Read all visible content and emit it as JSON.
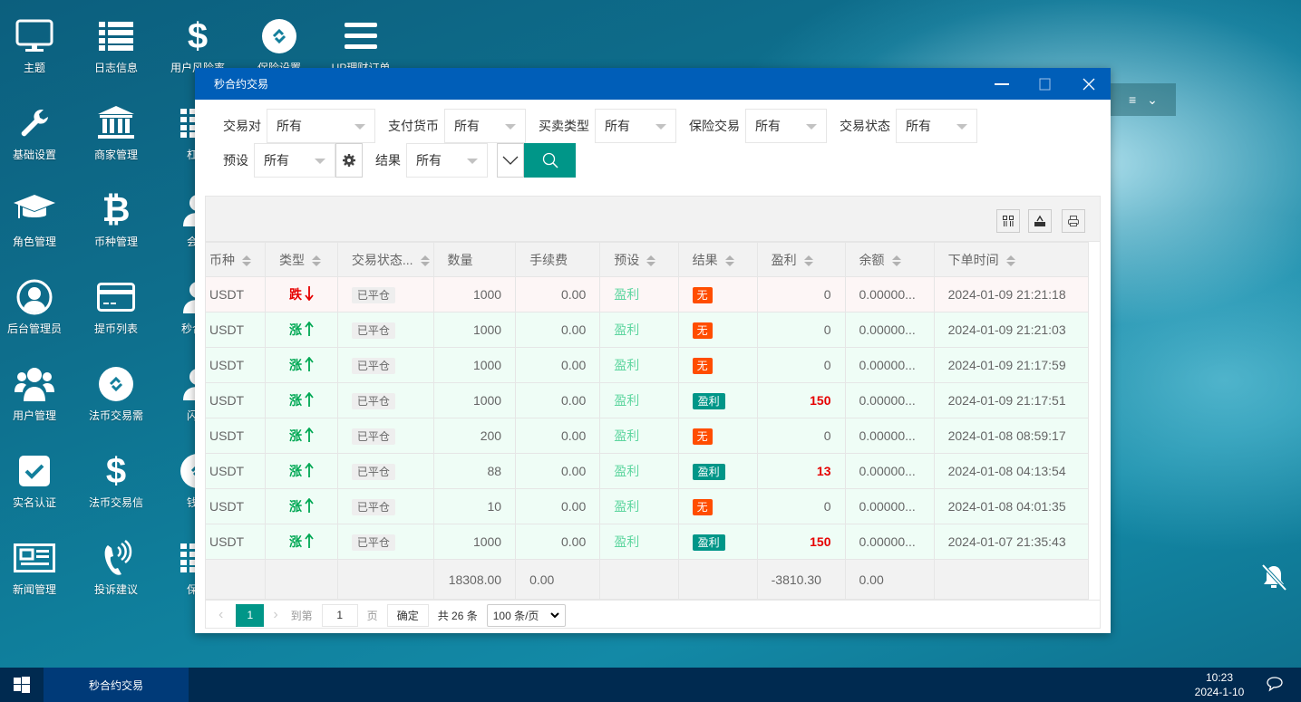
{
  "desktop": {
    "icons": [
      {
        "label": "主题",
        "icon": "monitor-icon"
      },
      {
        "label": "日志信息",
        "icon": "list-icon"
      },
      {
        "label": "用户风险率",
        "icon": "dollar-icon"
      },
      {
        "label": "保险设置",
        "icon": "link-circle-icon"
      },
      {
        "label": "UP理财订单",
        "icon": "menu-icon"
      },
      {
        "label": "基础设置",
        "icon": "wrench-icon"
      },
      {
        "label": "商家管理",
        "icon": "bank-icon"
      },
      {
        "label": "杠杆",
        "icon": "list-icon"
      },
      {
        "label": "角色管理",
        "icon": "graduation-cap-icon"
      },
      {
        "label": "币种管理",
        "icon": "bitcoin-icon"
      },
      {
        "label": "会员",
        "icon": "user-icon"
      },
      {
        "label": "后台管理员",
        "icon": "user-circle-icon"
      },
      {
        "label": "提币列表",
        "icon": "credit-card-icon"
      },
      {
        "label": "秒合约",
        "icon": "user-icon"
      },
      {
        "label": "用户管理",
        "icon": "users-icon"
      },
      {
        "label": "法币交易需",
        "icon": "link-circle-icon"
      },
      {
        "label": "闪兑",
        "icon": "user-icon"
      },
      {
        "label": "实名认证",
        "icon": "check-square-icon"
      },
      {
        "label": "法币交易信",
        "icon": "dollar-icon"
      },
      {
        "label": "钱包",
        "icon": "link-circle-icon"
      },
      {
        "label": "新闻管理",
        "icon": "newspaper-icon"
      },
      {
        "label": "投诉建议",
        "icon": "phone-volume-icon"
      },
      {
        "label": "保险",
        "icon": "list-icon"
      }
    ]
  },
  "window": {
    "title": "秒合约交易",
    "filters": {
      "row1": [
        {
          "label": "交易对",
          "value": "所有"
        },
        {
          "label": "支付货币",
          "value": "所有"
        },
        {
          "label": "买卖类型",
          "value": "所有"
        },
        {
          "label": "保险交易",
          "value": "所有"
        },
        {
          "label": "交易状态",
          "value": "所有"
        }
      ],
      "preset": {
        "label": "预设",
        "value": "所有"
      },
      "result": {
        "label": "结果",
        "value": "所有"
      }
    },
    "table": {
      "columns": [
        "币种",
        "类型",
        "交易状态...",
        "数量",
        "手续费",
        "预设",
        "结果",
        "盈利",
        "余额",
        "下单时间"
      ],
      "rows": [
        {
          "currency": "USDT",
          "type": "跌",
          "dir": "down",
          "status": "已平仓",
          "qty": "1000",
          "fee": "0.00",
          "preset": "盈利",
          "result": "无",
          "profit": "0",
          "balance": "0.00000...",
          "time": "2024-01-09 21:21:18"
        },
        {
          "currency": "USDT",
          "type": "涨",
          "dir": "up",
          "status": "已平仓",
          "qty": "1000",
          "fee": "0.00",
          "preset": "盈利",
          "result": "无",
          "profit": "0",
          "balance": "0.00000...",
          "time": "2024-01-09 21:21:03"
        },
        {
          "currency": "USDT",
          "type": "涨",
          "dir": "up",
          "status": "已平仓",
          "qty": "1000",
          "fee": "0.00",
          "preset": "盈利",
          "result": "无",
          "profit": "0",
          "balance": "0.00000...",
          "time": "2024-01-09 21:17:59"
        },
        {
          "currency": "USDT",
          "type": "涨",
          "dir": "up",
          "status": "已平仓",
          "qty": "1000",
          "fee": "0.00",
          "preset": "盈利",
          "result": "盈利",
          "profit": "150",
          "balance": "0.00000...",
          "time": "2024-01-09 21:17:51"
        },
        {
          "currency": "USDT",
          "type": "涨",
          "dir": "up",
          "status": "已平仓",
          "qty": "200",
          "fee": "0.00",
          "preset": "盈利",
          "result": "无",
          "profit": "0",
          "balance": "0.00000...",
          "time": "2024-01-08 08:59:17"
        },
        {
          "currency": "USDT",
          "type": "涨",
          "dir": "up",
          "status": "已平仓",
          "qty": "88",
          "fee": "0.00",
          "preset": "盈利",
          "result": "盈利",
          "profit": "13",
          "balance": "0.00000...",
          "time": "2024-01-08 04:13:54"
        },
        {
          "currency": "USDT",
          "type": "涨",
          "dir": "up",
          "status": "已平仓",
          "qty": "10",
          "fee": "0.00",
          "preset": "盈利",
          "result": "无",
          "profit": "0",
          "balance": "0.00000...",
          "time": "2024-01-08 04:01:35"
        },
        {
          "currency": "USDT",
          "type": "涨",
          "dir": "up",
          "status": "已平仓",
          "qty": "1000",
          "fee": "0.00",
          "preset": "盈利",
          "result": "盈利",
          "profit": "150",
          "balance": "0.00000...",
          "time": "2024-01-07 21:35:43"
        }
      ],
      "totals": {
        "qty": "18308.00",
        "fee": "0.00",
        "profit": "-3810.30",
        "balance": "0.00"
      }
    },
    "pager": {
      "current": "1",
      "goto_label": "到第",
      "goto_value": "1",
      "page_label": "页",
      "confirm": "确定",
      "total": "共 26 条",
      "page_size": "100 条/页"
    }
  },
  "taskbar": {
    "app": "秒合约交易",
    "time": "10:23",
    "date": "2024-1-10"
  },
  "colors": {
    "titlebar": "#005eb8",
    "accent": "#009688",
    "down": "#e60000",
    "up": "#00a854",
    "none_badge": "#ff4d00"
  }
}
